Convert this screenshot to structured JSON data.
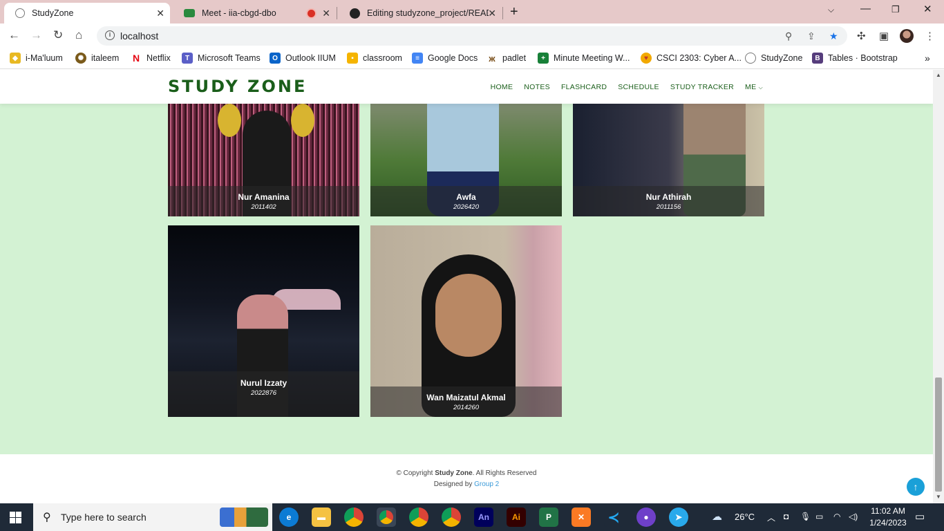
{
  "browser": {
    "tabs": [
      {
        "title": "StudyZone",
        "active": true
      },
      {
        "title": "Meet - iia-cbgd-dbo",
        "active": false
      },
      {
        "title": "Editing studyzone_project/READI",
        "active": false
      }
    ],
    "url": "localhost",
    "bookmarks": [
      "i-Ma'luum",
      "italeem",
      "Netflix",
      "Microsoft Teams",
      "Outlook IIUM",
      "classroom",
      "Google Docs",
      "padlet",
      "Minute Meeting W...",
      "CSCI 2303: Cyber A...",
      "StudyZone",
      "Tables · Bootstrap"
    ]
  },
  "site": {
    "logo": "STUDY ZONE",
    "nav": [
      "HOME",
      "NOTES",
      "FLASHCARD",
      "SCHEDULE",
      "STUDY TRACKER",
      "ME"
    ],
    "members": [
      {
        "name": "Nur Amanina",
        "id": "2011402"
      },
      {
        "name": "Awfa",
        "id": "2026420"
      },
      {
        "name": "Nur Athirah",
        "id": "2011156"
      },
      {
        "name": "Nurul Izzaty",
        "id": "2022876"
      },
      {
        "name": "Wan Maizatul Akmal",
        "id": "2014260"
      }
    ],
    "footer": {
      "copyright_prefix": "© Copyright",
      "brand": "Study Zone",
      "rights": ". All Rights Reserved",
      "designed_by": "Designed by",
      "group": "Group 2"
    }
  },
  "taskbar": {
    "search_placeholder": "Type here to search",
    "weather": "26°C",
    "time": "11:02 AM",
    "date": "1/24/2023"
  }
}
